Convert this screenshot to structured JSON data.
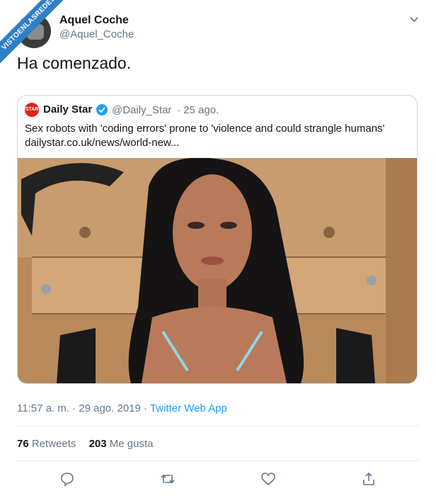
{
  "watermark": "VISTOENLASREDES",
  "author": {
    "name": "Aquel Coche",
    "handle": "@Aquel_Coche"
  },
  "tweet": {
    "text": "Ha comenzado."
  },
  "quote": {
    "logo_text": "STAR",
    "name": "Daily Star",
    "handle": "@Daily_Star",
    "date": "· 25 ago.",
    "text_line1": "Sex robots with 'coding errors' prone to 'violence and could strangle humans'",
    "text_line2": "dailystar.co.uk/news/world-new..."
  },
  "meta": {
    "time": "11:57 a. m. · 29 ago. 2019 · ",
    "source": "Twitter Web App"
  },
  "stats": {
    "retweets_count": "76",
    "retweets_label": "Retweets",
    "likes_count": "203",
    "likes_label": "Me gusta"
  },
  "colors": {
    "accent": "#1da1f2",
    "muted": "#657786",
    "text": "#14171a",
    "border": "#cfd9de",
    "brand_red": "#e0241b"
  },
  "icons": [
    "chevron-down-icon",
    "verified-badge-icon",
    "reply-icon",
    "retweet-icon",
    "like-icon",
    "share-icon"
  ]
}
